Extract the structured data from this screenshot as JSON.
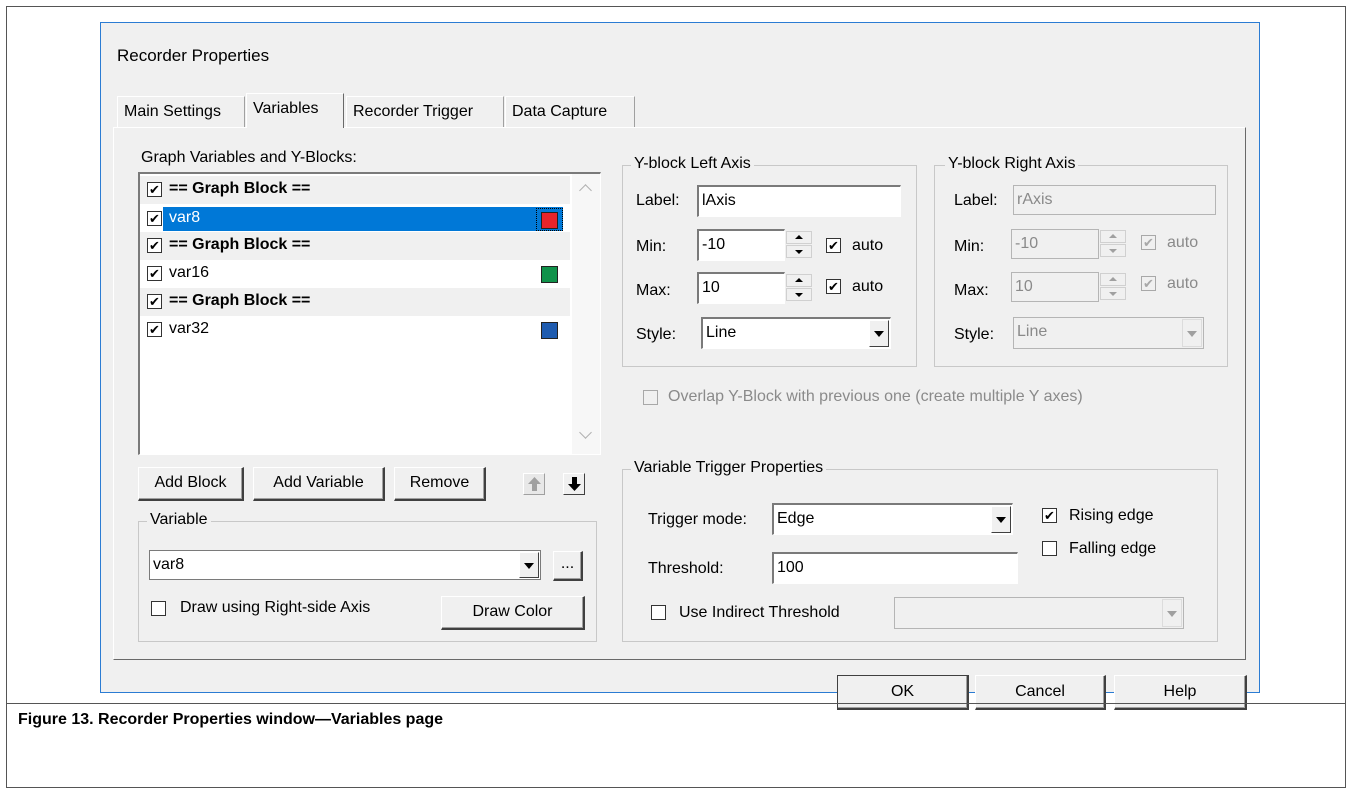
{
  "window": {
    "title": "Recorder Properties"
  },
  "tabs": [
    {
      "label": "Main Settings",
      "active": false
    },
    {
      "label": "Variables",
      "active": true
    },
    {
      "label": "Recorder Trigger",
      "active": false
    },
    {
      "label": "Data Capture",
      "active": false
    }
  ],
  "graph_list": {
    "label": "Graph Variables and Y-Blocks:",
    "items": [
      {
        "text": "== Graph Block ==",
        "type": "block",
        "checked": true
      },
      {
        "text": "var8",
        "type": "variable",
        "checked": true,
        "selected": true,
        "color": "#e8242a"
      },
      {
        "text": "== Graph Block ==",
        "type": "block",
        "checked": true
      },
      {
        "text": "var16",
        "type": "variable",
        "checked": true,
        "color": "#10924a"
      },
      {
        "text": "== Graph Block ==",
        "type": "block",
        "checked": true
      },
      {
        "text": "var32",
        "type": "variable",
        "checked": true,
        "color": "#1f5cb0"
      }
    ]
  },
  "list_buttons": {
    "add_block": "Add Block",
    "add_variable": "Add Variable",
    "remove": "Remove",
    "move_up_icon": "up-arrow-icon",
    "move_down_icon": "down-arrow-icon"
  },
  "variable_group": {
    "title": "Variable",
    "selected": "var8",
    "browse": "...",
    "right_axis_label": "Draw using Right-side Axis",
    "right_axis_checked": false,
    "draw_color": "Draw Color"
  },
  "left_axis": {
    "title": "Y-block Left Axis",
    "label_caption": "Label:",
    "label_value": "lAxis",
    "min_caption": "Min:",
    "min_value": "-10",
    "max_caption": "Max:",
    "max_value": "10",
    "auto": "auto",
    "min_auto": true,
    "max_auto": true,
    "style_caption": "Style:",
    "style_value": "Line"
  },
  "right_axis": {
    "title": "Y-block Right Axis",
    "label_caption": "Label:",
    "label_value": "rAxis",
    "min_caption": "Min:",
    "min_value": "-10",
    "max_caption": "Max:",
    "max_value": "10",
    "auto": "auto",
    "min_auto": true,
    "max_auto": true,
    "style_caption": "Style:",
    "style_value": "Line",
    "disabled": true
  },
  "overlap": {
    "label": "Overlap Y-Block with previous one (create multiple Y axes)",
    "checked": false,
    "disabled": true
  },
  "trigger": {
    "title": "Variable Trigger Properties",
    "mode_caption": "Trigger mode:",
    "mode_value": "Edge",
    "threshold_caption": "Threshold:",
    "threshold_value": "100",
    "indirect_label": "Use Indirect Threshold",
    "indirect_checked": false,
    "indirect_value": "",
    "rising_label": "Rising edge",
    "rising_checked": true,
    "falling_label": "Falling edge",
    "falling_checked": false
  },
  "footer": {
    "ok": "OK",
    "cancel": "Cancel",
    "help": "Help"
  },
  "caption": "Figure 13. Recorder Properties window—Variables page",
  "colors": {
    "selection": "#0078d7",
    "dialog_bg": "#f0f0f0",
    "window_border": "#2b7cd3"
  }
}
